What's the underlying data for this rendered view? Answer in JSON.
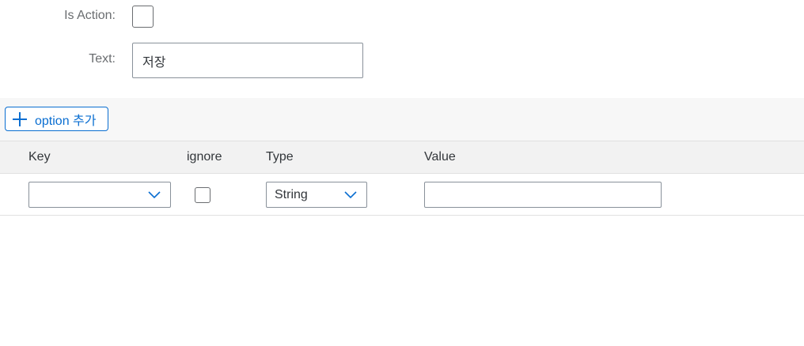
{
  "form": {
    "is_action_label": "Is Action:",
    "is_action_checked": false,
    "text_label": "Text:",
    "text_value": "저장"
  },
  "toolbar": {
    "add_option_label": "option 추가"
  },
  "table": {
    "columns": [
      "Key",
      "ignore",
      "Type",
      "Value"
    ],
    "rows": [
      {
        "key": "",
        "ignore": false,
        "type": "String",
        "value": ""
      }
    ]
  },
  "colors": {
    "accent": "#0a6ed1",
    "label": "#6a6d70",
    "text": "#32363a",
    "toolbar_bg": "#f7f7f7",
    "header_bg": "#f2f2f2",
    "border": "#89919a"
  },
  "icons": {
    "add": "plus-icon",
    "dropdown": "chevron-down-icon"
  }
}
